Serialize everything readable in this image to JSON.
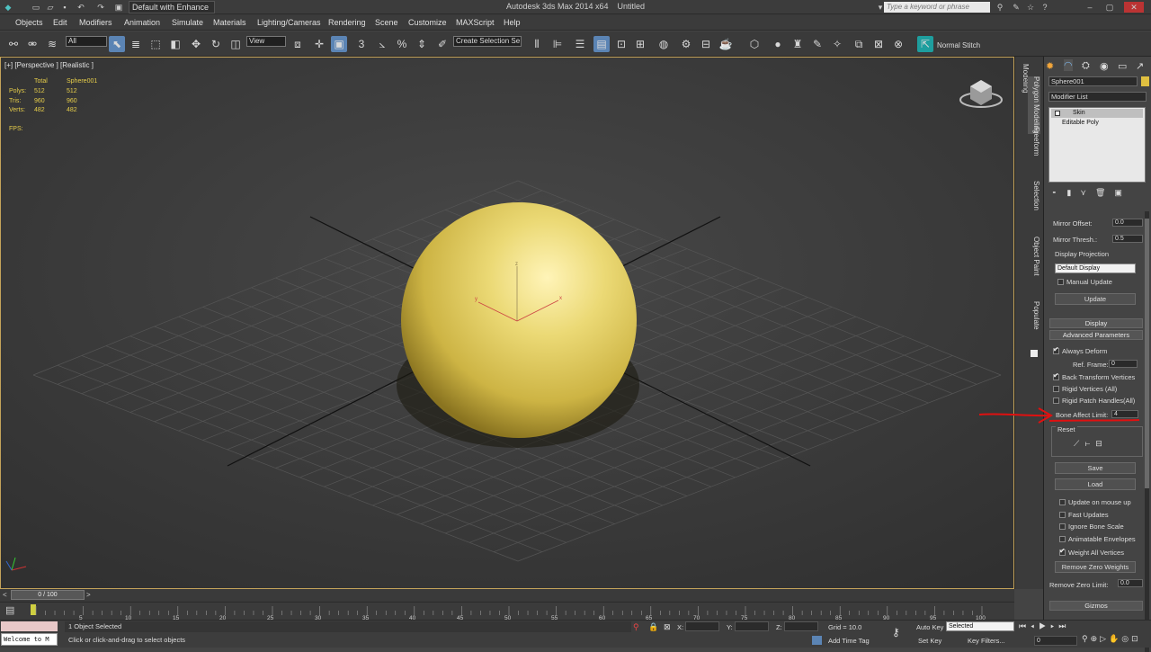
{
  "app": {
    "title": "Autodesk 3ds Max 2014 x64",
    "document": "Untitled",
    "workspace": "Default with Enhance",
    "search_placeholder": "Type a keyword or phrase"
  },
  "menu": [
    "Objects",
    "Edit",
    "Modifiers",
    "Animation",
    "Simulate",
    "Materials",
    "Lighting/Cameras",
    "Rendering",
    "Scene",
    "Customize",
    "MAXScript",
    "Help"
  ],
  "toolbar": {
    "selection_filter": "All",
    "ref_coord": "View",
    "named_selection": "Create Selection Se",
    "normal_stitch": "Normal Stitch"
  },
  "viewport": {
    "label": "[+] [Perspective ] [Realistic ]",
    "stats": {
      "header_total": "Total",
      "header_object": "Sphere001",
      "polys_label": "Polys:",
      "polys_total": "512",
      "polys_obj": "512",
      "tris_label": "Tris:",
      "tris_total": "960",
      "tris_obj": "960",
      "verts_label": "Verts:",
      "verts_total": "482",
      "verts_obj": "482",
      "fps_label": "FPS:"
    },
    "axis": {
      "x": "x",
      "y": "y",
      "z": "z"
    }
  },
  "ribbon": {
    "tabs": [
      "Modeling",
      "Freeform",
      "Selection",
      "Object Paint",
      "Populate"
    ],
    "sub_tab": "Polygon Modeling"
  },
  "command_panel": {
    "object_name": "Sphere001",
    "object_color": "#e0c040",
    "modifier_list": "Modifier List",
    "stack": [
      "Skin",
      "Editable Poly"
    ],
    "mirror_offset_label": "Mirror Offset:",
    "mirror_offset_value": "0.0",
    "mirror_thresh_label": "Mirror Thresh.:",
    "mirror_thresh_value": "0.5",
    "display_projection_label": "Display Projection",
    "display_projection_value": "Default Display",
    "manual_update_label": "Manual Update",
    "update_button": "Update",
    "display_rollout": "Display",
    "advanced_rollout": "Advanced Parameters",
    "always_deform": "Always Deform",
    "ref_frame_label": "Ref. Frame:",
    "ref_frame_value": "0",
    "back_transform": "Back Transform Vertices",
    "rigid_vertices": "Rigid Vertices (All)",
    "rigid_patch": "Rigid Patch Handles(All)",
    "bone_affect_label": "Bone Affect Limit:",
    "bone_affect_value": "4",
    "reset_label": "Reset",
    "save_button": "Save",
    "load_button": "Load",
    "update_on_mouse": "Update on mouse up",
    "fast_updates": "Fast Updates",
    "ignore_bone_scale": "Ignore Bone Scale",
    "animatable_envelopes": "Animatable Envelopes",
    "weight_all_vertices": "Weight All Vertices",
    "remove_zero_button": "Remove Zero Weights",
    "remove_zero_limit_label": "Remove Zero Limit:",
    "remove_zero_limit_value": "0.0",
    "gizmos_rollout": "Gizmos"
  },
  "timeline": {
    "frame": "0 / 100",
    "ticks": [
      "5",
      "10",
      "15",
      "20",
      "25",
      "30",
      "35",
      "40",
      "45",
      "50",
      "55",
      "60",
      "65",
      "70",
      "75",
      "80",
      "85",
      "90",
      "95",
      "100"
    ]
  },
  "status": {
    "maxscript": "Welcome to M",
    "selected": "1 Object Selected",
    "prompt": "Click or click-and-drag to select objects",
    "x_label": "X:",
    "y_label": "Y:",
    "z_label": "Z:",
    "grid": "Grid = 10.0",
    "auto_key": "Auto Key",
    "selected_dropdown": "Selected",
    "set_key": "Set Key",
    "key_filters": "Key Filters...",
    "add_time_tag": "Add Time Tag",
    "frame_value": "0"
  }
}
